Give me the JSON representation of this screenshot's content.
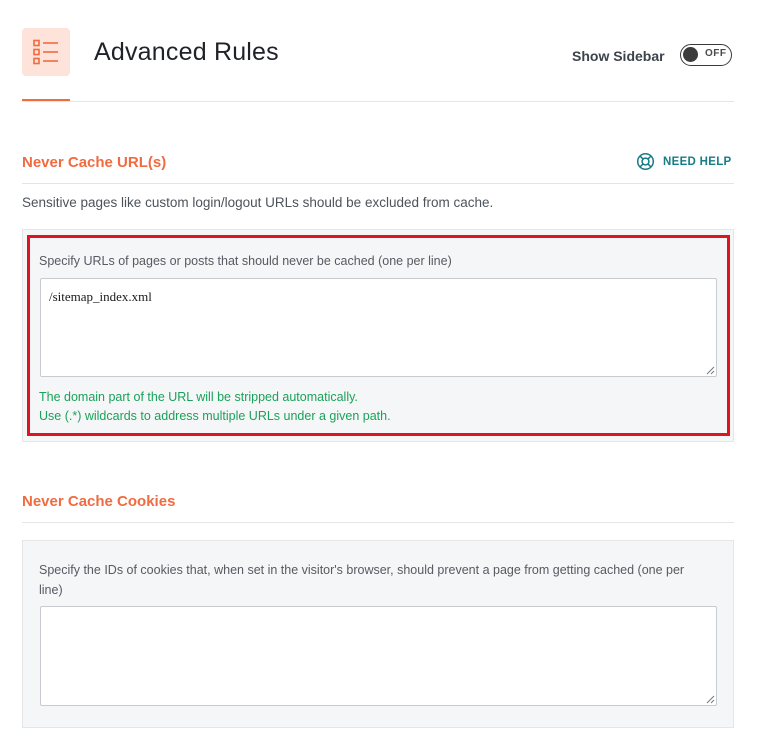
{
  "header": {
    "title": "Advanced Rules",
    "icon": "checklist-icon",
    "sidebar_label": "Show Sidebar",
    "sidebar_toggle": {
      "state": "OFF"
    },
    "accent_color": "#f06b40"
  },
  "never_cache_urls": {
    "title": "Never Cache URL(s)",
    "help_label": "NEED HELP",
    "help_icon": "lifebuoy-icon",
    "description": "Sensitive pages like custom login/logout URLs should be excluded from cache.",
    "field_label": "Specify URLs of pages or posts that should never be cached (one per line)",
    "value": "/sitemap_index.xml",
    "hint_1": "The domain part of the URL will be stripped automatically.",
    "hint_2": "Use (.*) wildcards to address multiple URLs under a given path."
  },
  "never_cache_cookies": {
    "title": "Never Cache Cookies",
    "field_label_1": "Specify the IDs of cookies that, when set in the visitor's browser, should prevent a page from getting cached (one per",
    "field_label_2": "line)",
    "value": ""
  }
}
